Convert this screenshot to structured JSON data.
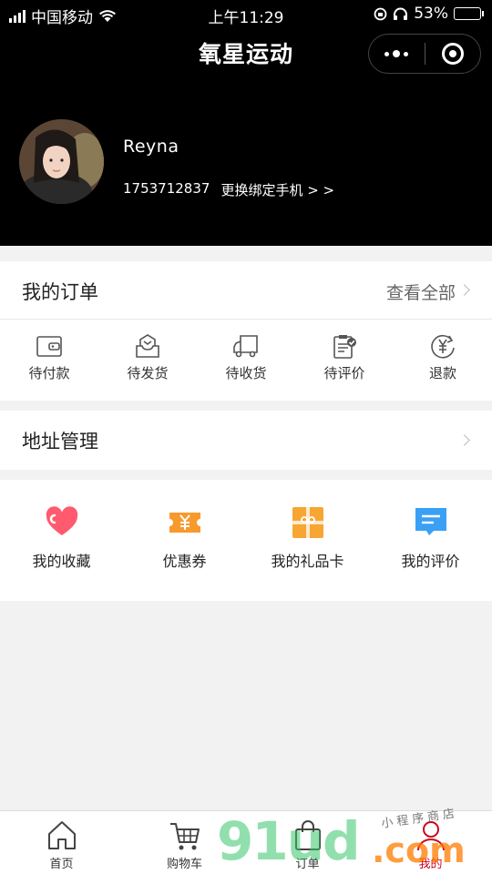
{
  "status_bar": {
    "carrier": "中国移动",
    "time": "上午11:29",
    "battery_percent": "53%",
    "battery_level": 0.53
  },
  "header": {
    "title": "氧星运动"
  },
  "profile": {
    "name": "Reyna",
    "phone": "1753712837",
    "change_phone": "更换绑定手机 > >"
  },
  "orders": {
    "title": "我的订单",
    "view_all": "查看全部",
    "items": [
      {
        "label": "待付款",
        "icon": "wallet-icon"
      },
      {
        "label": "待发货",
        "icon": "package-icon"
      },
      {
        "label": "待收货",
        "icon": "truck-icon"
      },
      {
        "label": "待评价",
        "icon": "clipboard-check-icon"
      },
      {
        "label": "退款",
        "icon": "yen-refund-icon"
      }
    ]
  },
  "address": {
    "title": "地址管理"
  },
  "services": [
    {
      "label": "我的收藏",
      "icon": "heart-icon",
      "color": "#ff5a6e"
    },
    {
      "label": "优惠券",
      "icon": "coupon-icon",
      "color": "#f79a2e"
    },
    {
      "label": "我的礼品卡",
      "icon": "gift-card-icon",
      "color": "#f7a533"
    },
    {
      "label": "我的评价",
      "icon": "comment-icon",
      "color": "#3aa0f5"
    }
  ],
  "tabbar": [
    {
      "label": "首页",
      "icon": "home-icon"
    },
    {
      "label": "购物车",
      "icon": "cart-icon"
    },
    {
      "label": "订单",
      "icon": "bag-icon"
    },
    {
      "label": "我的",
      "icon": "user-icon",
      "active": true
    }
  ],
  "watermark": {
    "main": "91ud",
    "domain": ".com",
    "sub": "小程序商店"
  },
  "colors": {
    "header_bg": "#000000",
    "active_tab": "#d0021b",
    "page_bg": "#f2f2f2"
  }
}
